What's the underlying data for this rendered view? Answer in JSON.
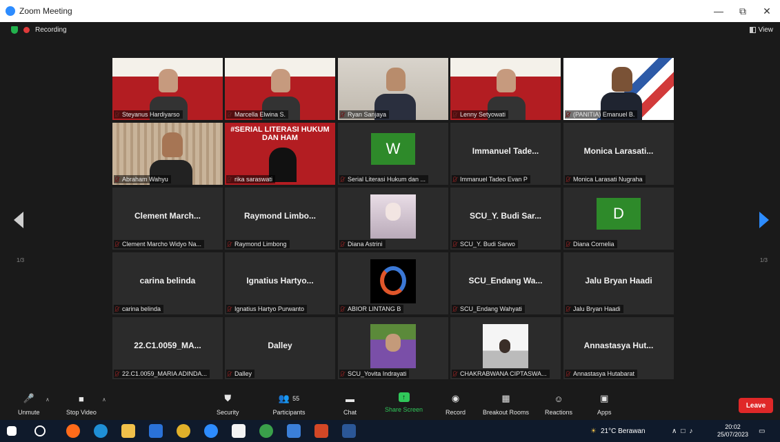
{
  "window": {
    "title": "Zoom Meeting",
    "minimize": "—",
    "restore": "⧉",
    "close": "✕"
  },
  "recording": {
    "label": "Recording"
  },
  "view": {
    "label": "View"
  },
  "pagination": {
    "left": "1/3",
    "right": "1/3"
  },
  "tiles": [
    {
      "display": "",
      "tag": "Steyanus Hardiyarso",
      "type": "banner"
    },
    {
      "display": "",
      "tag": "Marcella Elwina S.",
      "type": "banner"
    },
    {
      "display": "",
      "tag": "Ryan Sanjaya",
      "type": "room"
    },
    {
      "display": "",
      "tag": "Lenny Setyowati",
      "type": "banner"
    },
    {
      "display": "",
      "tag": "(PANITIA) Emanuel B.",
      "type": "white"
    },
    {
      "display": "",
      "tag": "Abraham Wahyu",
      "type": "curtain"
    },
    {
      "display": "",
      "tag": "rika saraswati",
      "type": "big",
      "banner": "#SERIAL LITERASI HUKUM DAN HAM"
    },
    {
      "display": "",
      "tag": "Serial Literasi Hukum dan ...",
      "type": "letter",
      "letter": "W"
    },
    {
      "display": "Immanuel  Tade...",
      "tag": "Immanuel Tadeo Evan P",
      "type": "name"
    },
    {
      "display": "Monica  Larasati...",
      "tag": "Monica Larasati Nugraha",
      "type": "name"
    },
    {
      "display": "Clement  March...",
      "tag": "Clement Marcho Widyo Na...",
      "type": "name"
    },
    {
      "display": "Raymond  Limbo...",
      "tag": "Raymond Limbong",
      "type": "name"
    },
    {
      "display": "",
      "tag": "Diana Astrini",
      "type": "anime"
    },
    {
      "display": "SCU_Y. Budi Sar...",
      "tag": "SCU_Y. Budi Sarwo",
      "type": "name"
    },
    {
      "display": "",
      "tag": "Diana Cornelia",
      "type": "letter",
      "letter": "D"
    },
    {
      "display": "carina belinda",
      "tag": "carina belinda",
      "type": "name"
    },
    {
      "display": "Ignatius  Hartyo...",
      "tag": "Ignatius Hartyo Purwanto",
      "type": "name"
    },
    {
      "display": "",
      "tag": "ABIOR LINTANG B",
      "type": "logo"
    },
    {
      "display": "SCU_Endang  Wa...",
      "tag": "SCU_Endang Wahyati",
      "type": "name"
    },
    {
      "display": "Jalu Bryan Haadi",
      "tag": "Jalu Bryan Haadi",
      "type": "name"
    },
    {
      "display": "22.C1.0059_MA...",
      "tag": "22.C1.0059_MARIA ADINDA...",
      "type": "name"
    },
    {
      "display": "Dalley",
      "tag": "Dalley",
      "type": "name"
    },
    {
      "display": "",
      "tag": "SCU_Yovita Indrayati",
      "type": "yovita"
    },
    {
      "display": "",
      "tag": "CHAKRABWANA CIPTASWA...",
      "type": "chak"
    },
    {
      "display": "Annastasya  Hut...",
      "tag": "Annastasya Hutabarat",
      "type": "name"
    }
  ],
  "toolbar": {
    "unmute": "Unmute",
    "stop_video": "Stop Video",
    "security": "Security",
    "participants": "Participants",
    "participants_count": "55",
    "chat": "Chat",
    "share_screen": "Share Screen",
    "record": "Record",
    "breakout": "Breakout Rooms",
    "reactions": "Reactions",
    "apps": "Apps",
    "leave": "Leave"
  },
  "taskbar": {
    "weather": "21°C  Berawan",
    "time": "20:02",
    "date": "25/07/2023"
  },
  "colors": {
    "accent": "#2d8cff",
    "leave": "#e02828",
    "share": "#30c85a",
    "active_border": "#d9e84a"
  }
}
